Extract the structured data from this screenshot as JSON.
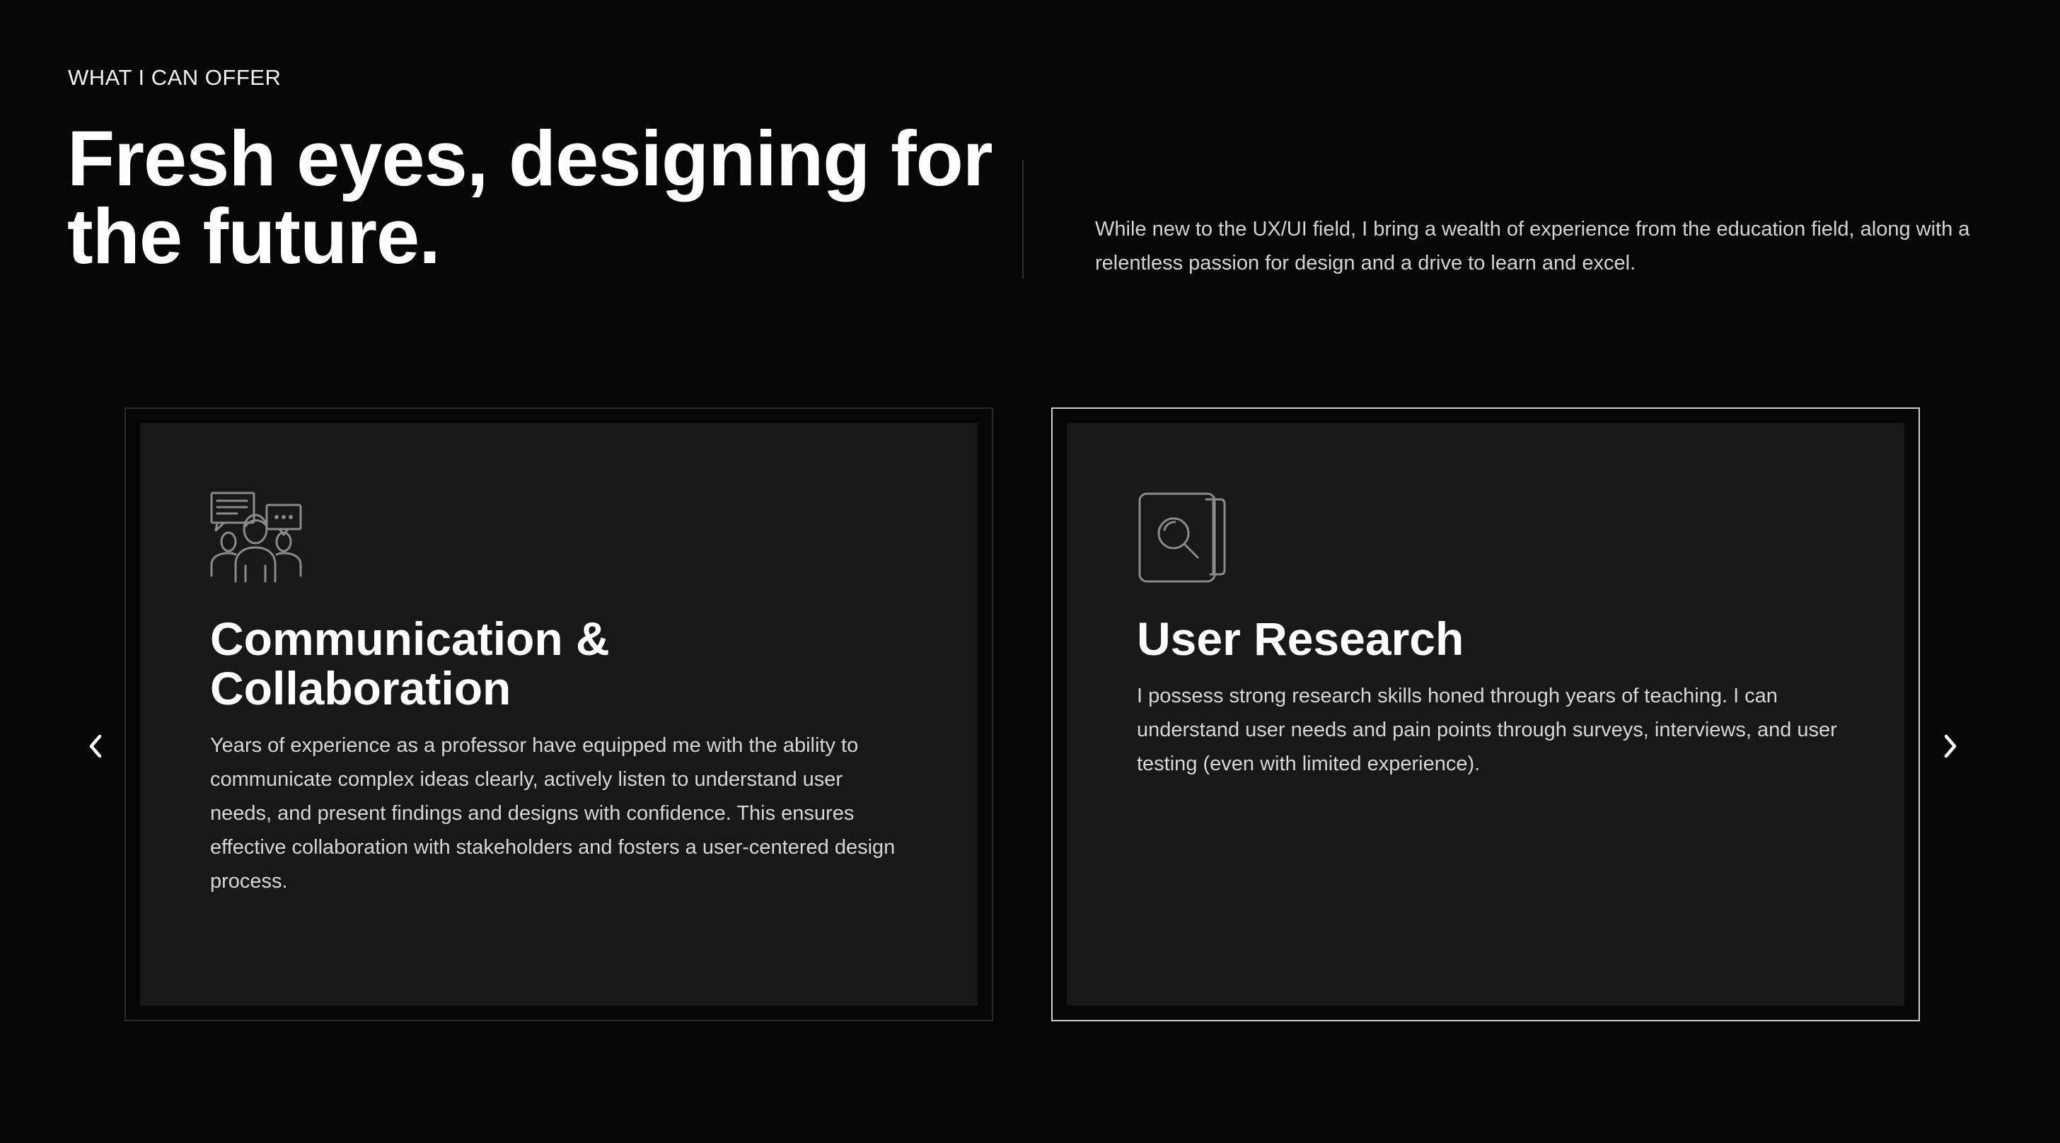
{
  "section": {
    "eyebrow": "WHAT I CAN OFFER",
    "headline": "Fresh eyes, designing for the future.",
    "intro": "While new to the UX/UI field, I bring a wealth of experience from the education field, along with a relentless passion for design and a drive to learn and excel."
  },
  "cards": [
    {
      "icon": "people-chat-icon",
      "title": "Communication & Collaboration",
      "body": "Years of experience as a professor have equipped me with the ability to communicate complex ideas clearly, actively listen to understand user needs, and present findings and designs with confidence. This ensures effective collaboration with stakeholders and fosters a user-centered design process."
    },
    {
      "icon": "document-search-icon",
      "title": "User Research",
      "body": "I possess strong research skills honed through years of teaching. I can understand user needs and pain points through surveys, interviews, and user testing (even with limited experience)."
    }
  ],
  "carousel": {
    "prev_icon": "chevron-left-icon",
    "next_icon": "chevron-right-icon"
  },
  "colors": {
    "background": "#060606",
    "card": "#181818",
    "active_card_border": "#cfcfcf",
    "text": "#ffffff",
    "muted_text": "#d6d6d6",
    "icon_stroke": "#8a8a8a"
  }
}
